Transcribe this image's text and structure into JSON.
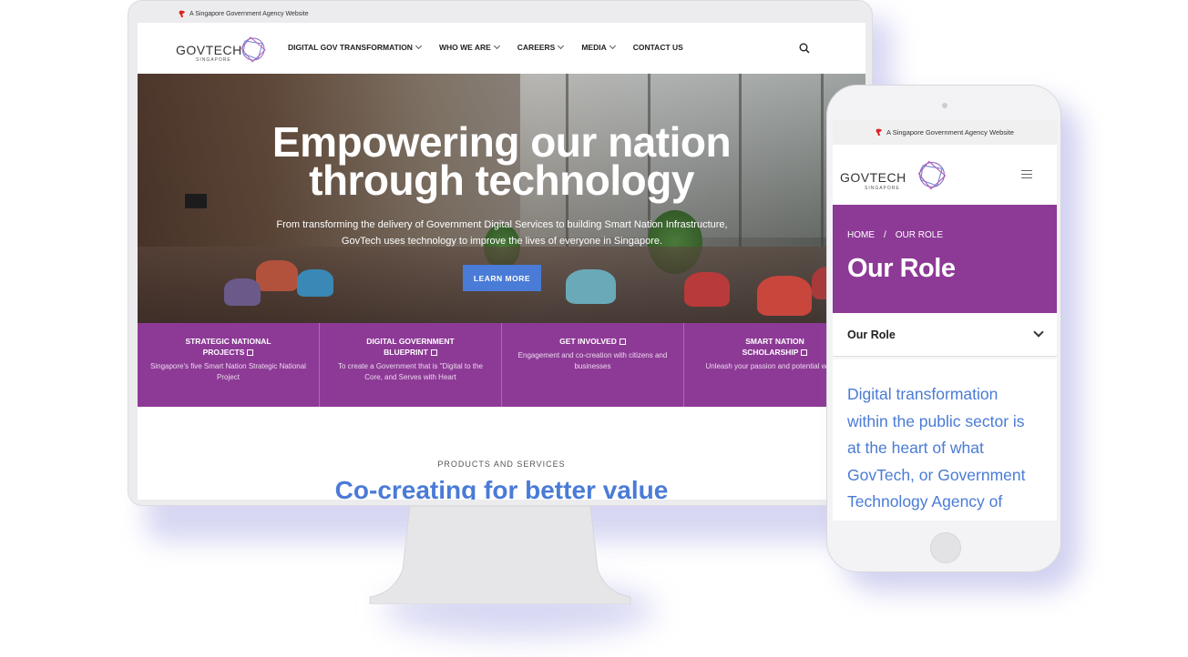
{
  "desktop": {
    "gov_strip": "A Singapore Government Agency Website",
    "logo": {
      "text": "GOVTECH",
      "sub": "SINGAPORE"
    },
    "nav": [
      {
        "label": "DIGITAL GOV TRANSFORMATION",
        "dropdown": true
      },
      {
        "label": "WHO WE ARE",
        "dropdown": true
      },
      {
        "label": "CAREERS",
        "dropdown": true
      },
      {
        "label": "MEDIA",
        "dropdown": true
      },
      {
        "label": "CONTACT US",
        "dropdown": false
      }
    ],
    "hero": {
      "title_line1": "Empowering our nation",
      "title_line2": "through technology",
      "desc_line1": "From transforming the delivery of Government Digital Services to building Smart Nation Infrastructure,",
      "desc_line2": "GovTech uses technology to improve the lives of everyone in Singapore.",
      "cta": "LEARN MORE"
    },
    "band": [
      {
        "head1": "STRATEGIC NATIONAL",
        "head2": "PROJECTS",
        "desc": "Singapore's five Smart Nation Strategic National Project"
      },
      {
        "head1": "DIGITAL GOVERNMENT",
        "head2": "BLUEPRINT",
        "desc": "To create a Government that is \"Digital to the Core, and Serves with Heart"
      },
      {
        "head1": "GET INVOLVED",
        "head2": "",
        "desc": "Engagement and co-creation with citizens and businesses"
      },
      {
        "head1": "SMART NATION",
        "head2": "SCHOLARSHIP",
        "desc": "Unleash your passion and potential with us"
      }
    ],
    "products_label": "PRODUCTS AND SERVICES",
    "products_title": "Co-creating for better value"
  },
  "phone": {
    "gov_strip": "A Singapore Government Agency Website",
    "logo": {
      "text": "GOVTECH",
      "sub": "SINGAPORE"
    },
    "breadcrumb": {
      "home": "HOME",
      "sep": "/",
      "current": "OUR ROLE"
    },
    "title": "Our Role",
    "accordion_label": "Our Role",
    "body_lines": [
      "Digital transformation",
      "within the public sector is",
      "at the heart of what",
      "GovTech, or Government",
      "Technology Agency of"
    ]
  },
  "colors": {
    "purple": "#8d3a96",
    "accent_blue": "#4a7bd6"
  },
  "icons": [
    "lion-head-icon",
    "govtech-logo-mark",
    "chevron-down-icon",
    "search-icon",
    "external-link-icon",
    "hamburger-menu-icon"
  ]
}
